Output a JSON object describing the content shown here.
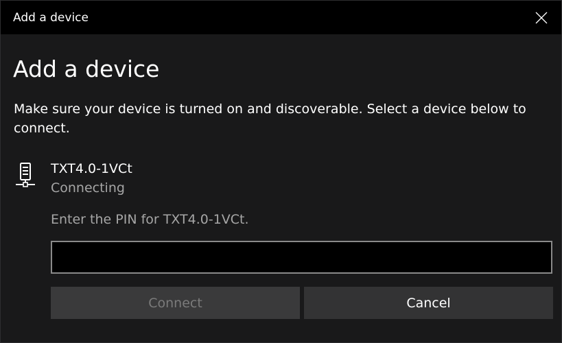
{
  "window": {
    "title": "Add a device",
    "close_icon": "close-icon"
  },
  "dialog": {
    "heading": "Add a device",
    "instructions": "Make sure your device is turned on and discoverable. Select a device below to connect."
  },
  "device": {
    "icon": "network-device-icon",
    "name": "TXT4.0-1VCt",
    "status": "Connecting"
  },
  "pin": {
    "label": "Enter the PIN for TXT4.0-1VCt.",
    "value": "",
    "placeholder": ""
  },
  "buttons": {
    "connect_label": "Connect",
    "connect_enabled": false,
    "cancel_label": "Cancel"
  },
  "colors": {
    "titlebar": "#000000",
    "body": "#19191a",
    "text_primary": "#ffffff",
    "text_secondary": "#a6a6a6",
    "input_border": "#8a8a8a",
    "button_bg": "#333334",
    "button_disabled_text": "#7b7b7b"
  }
}
